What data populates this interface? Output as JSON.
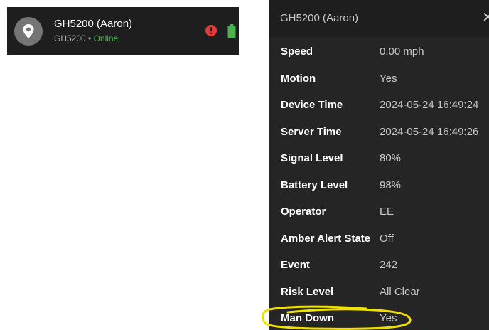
{
  "device_card": {
    "name": "GH5200 (Aaron)",
    "id": "GH5200",
    "separator": "•",
    "status": "Online",
    "avatar_icon": "map-pin-icon",
    "alert_icon": "exclamation-circle-icon",
    "battery_icon": "battery-full-icon",
    "colors": {
      "background": "#1e1e1e",
      "online": "#4caf50",
      "alert": "#e53935",
      "battery": "#4caf50"
    }
  },
  "popup": {
    "title": "GH5200 (Aaron)",
    "close_icon": "close-icon",
    "close_label": "✕",
    "rows": [
      {
        "label": "Speed",
        "value": "0.00 mph"
      },
      {
        "label": "Motion",
        "value": "Yes"
      },
      {
        "label": "Device Time",
        "value": "2024-05-24 16:49:24"
      },
      {
        "label": "Server Time",
        "value": "2024-05-24 16:49:26"
      },
      {
        "label": "Signal Level",
        "value": "80%"
      },
      {
        "label": "Battery Level",
        "value": "98%"
      },
      {
        "label": "Operator",
        "value": "EE"
      },
      {
        "label": "Amber Alert State",
        "value": "Off"
      },
      {
        "label": "Event",
        "value": "242"
      },
      {
        "label": "Risk Level",
        "value": "All Clear"
      },
      {
        "label": "Man Down",
        "value": "Yes"
      }
    ],
    "highlight_color": "#f0e000"
  }
}
